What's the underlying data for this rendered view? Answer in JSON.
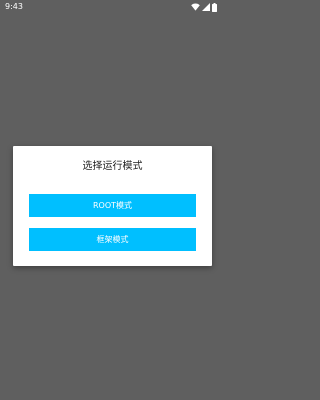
{
  "status_bar": {
    "time": "9:43",
    "icons": [
      "wifi-icon",
      "cellular-icon",
      "battery-icon"
    ]
  },
  "dialog": {
    "title": "选择运行模式",
    "buttons": [
      {
        "label": "ROOT模式"
      },
      {
        "label": "框架模式"
      }
    ]
  },
  "colors": {
    "background_overlay": "#5f5f5f",
    "dialog_background": "#ffffff",
    "button_accent": "#00bfff",
    "button_text": "#ffffff"
  }
}
